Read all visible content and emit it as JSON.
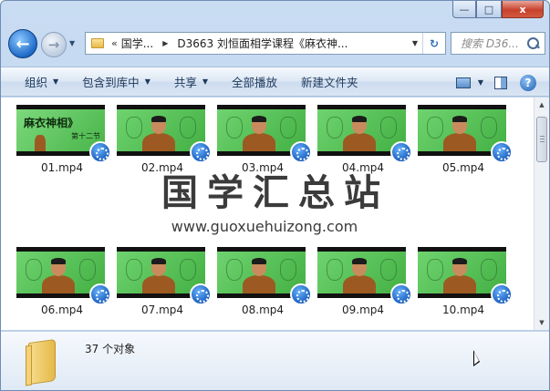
{
  "window": {
    "minimize_glyph": "—",
    "maximize_glyph": "□",
    "close_glyph": "x"
  },
  "nav": {
    "back_glyph": "←",
    "forward_glyph": "→",
    "history_caret": "▼"
  },
  "address": {
    "overflow": "«",
    "crumbs": [
      "国学...",
      "D3663 刘恒面相学课程《麻衣神..."
    ],
    "separator": "▶",
    "drop_caret": "▼",
    "refresh_glyph": "↻"
  },
  "search": {
    "placeholder": "搜索 D36..."
  },
  "commands": {
    "organize": "组织",
    "include_library": "包含到库中",
    "share": "共享",
    "play_all": "全部播放",
    "new_folder": "新建文件夹",
    "caret": "▼",
    "help": "?"
  },
  "files": [
    {
      "name": "01.mp4",
      "thumb": "title"
    },
    {
      "name": "02.mp4",
      "thumb": "lecture"
    },
    {
      "name": "03.mp4",
      "thumb": "lecture"
    },
    {
      "name": "04.mp4",
      "thumb": "lecture"
    },
    {
      "name": "05.mp4",
      "thumb": "lecture"
    },
    {
      "name": "06.mp4",
      "thumb": "lecture"
    },
    {
      "name": "07.mp4",
      "thumb": "lecture"
    },
    {
      "name": "08.mp4",
      "thumb": "lecture"
    },
    {
      "name": "09.mp4",
      "thumb": "lecture"
    },
    {
      "name": "10.mp4",
      "thumb": "lecture"
    }
  ],
  "thumb_title": {
    "text": "麻衣神相》",
    "sub": "第十二节"
  },
  "watermark": {
    "title": "国学汇总站",
    "url": "www.guoxuehuizong.com"
  },
  "scroll": {
    "up": "▲",
    "down": "▼"
  },
  "details": {
    "count": "37 个对象"
  },
  "colors": {
    "board_green": "#55bb55",
    "accent_blue": "#1d6ac7",
    "command_text": "#1e395b"
  }
}
